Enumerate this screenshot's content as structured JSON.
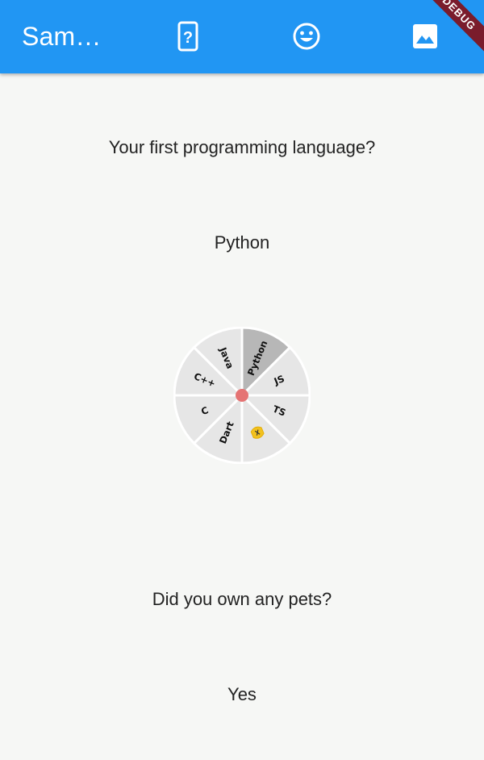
{
  "appbar": {
    "title": "Sam…",
    "actions": [
      {
        "icon": "phone-question-icon"
      },
      {
        "icon": "smiley-icon"
      },
      {
        "icon": "image-icon"
      }
    ],
    "color": "#2196f3"
  },
  "debug_banner": {
    "label": "DEBUG"
  },
  "questions": [
    {
      "text": "Your first programming language?",
      "answer": "Python"
    },
    {
      "text": "Did you own any pets?",
      "answer": "Yes"
    }
  ],
  "wheel": {
    "segments": [
      {
        "label": "Python",
        "selected": true
      },
      {
        "label": "JS",
        "selected": false
      },
      {
        "label": "TS",
        "selected": false
      },
      {
        "label": "",
        "icon": "flutter-logo-icon",
        "selected": false
      },
      {
        "label": "Dart",
        "selected": false
      },
      {
        "label": "C",
        "selected": false
      },
      {
        "label": "C++",
        "selected": false
      },
      {
        "label": "Java",
        "selected": false
      }
    ],
    "colors": {
      "segment": "#e6e6e6",
      "selected": "#b7b7b7",
      "center_dot": "#e57373"
    }
  }
}
